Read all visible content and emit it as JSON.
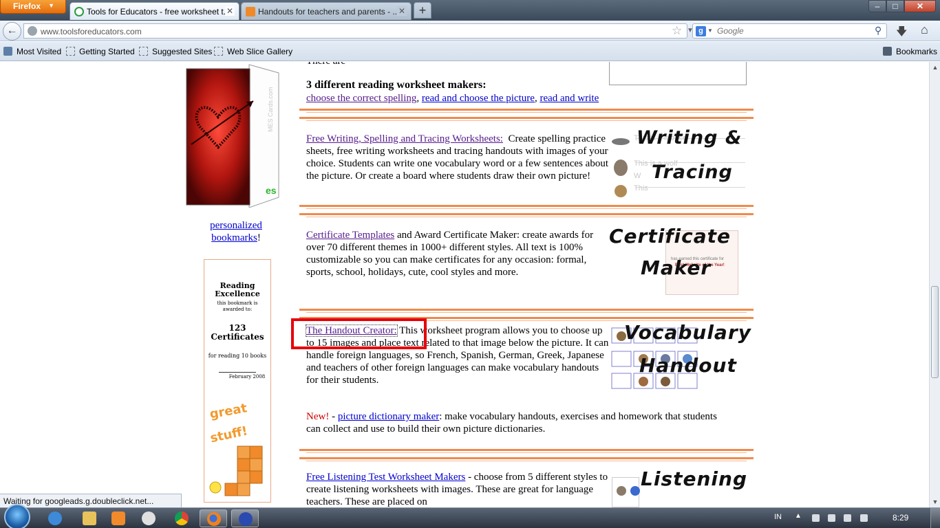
{
  "browser": {
    "app_button": "Firefox",
    "tabs": [
      {
        "title": "Tools for Educators - free worksheet t...",
        "active": true
      },
      {
        "title": "Handouts for teachers and parents - ...",
        "active": false
      }
    ],
    "new_tab": "+",
    "window_controls": {
      "minimize": "–",
      "maximize": "□",
      "close": "✕"
    },
    "url": "www.toolsforeducators.com",
    "search_placeholder": "Google",
    "search_engine_letter": "g",
    "bookmarks": [
      "Most Visited",
      "Getting Started",
      "Suggested Sites",
      "Web Slice Gallery"
    ],
    "bookmarks_menu": "Bookmarks",
    "status": "Waiting for googleads.g.doubleclick.net..."
  },
  "sidebar": {
    "card_watermark": "MES Cards.com",
    "bookmarks_link": "personalized bookmarks",
    "bookmarks_suffix": "!",
    "sample_bookmark": {
      "title": "Reading Excellence",
      "awarded": "this bookmark is awarded to:",
      "count": "123",
      "count_label": "Certificates",
      "for": "for reading 10 books",
      "date": "February 2008",
      "art_text": "great stuff!"
    }
  },
  "content": {
    "top_partial": "There are",
    "reading_heading": "3 different reading worksheet makers:",
    "reading_links": [
      "choose the correct spelling",
      "read and choose the picture",
      "read and write"
    ],
    "sections": [
      {
        "link": "Free Writing, Spelling and Tracing Worksheets:",
        "text": "Create spelling practice sheets, free writing worksheets and tracing handouts with images of your choice.  Students can write one vocabulary word or a few sentences about the picture.  Or create a board where students draw their own picture!",
        "thumb_words": [
          "Writing &",
          "Tracing"
        ],
        "thumb_bg_lines": [
          "This is a mouse",
          "This is a wolf",
          "W",
          "This"
        ]
      },
      {
        "link": "Certificate Templates",
        "text": "and Award Certificate Maker:  create awards for over 70 different themes in 1000+ different styles.  All text is 100% customizable so you can make certificates for any occasion: formal, sports, school, holidays, cute, cool styles and more.",
        "thumb_words": [
          "Certificate",
          "Maker"
        ],
        "thumb_bg_lines": [
          "has earned this certificate for",
          "Best Website of the Year!"
        ]
      },
      {
        "link": "The Handout Creator:",
        "text": "This worksheet program allows you to choose up to 15 images and place text related to that image below the picture.  It can handle foreign languages, so French, Spanish, German, Greek, Japanese and teachers of other foreign languages can make vocabulary handouts for their students.",
        "new_label": "New!",
        "new_dash": " - ",
        "new_link": "picture dictionary maker",
        "new_text": ": make vocabulary handouts, exercises and homework that students can collect and use to build their own picture dictionaries.",
        "thumb_words": [
          "Vocabulary",
          "Handout"
        ]
      },
      {
        "link": "Free Listening Test Worksheet Makers",
        "text": " - choose from 5 different styles to create listening worksheets with images.  These are great for language teachers. These are placed on",
        "thumb_words": [
          "Listening"
        ]
      }
    ]
  },
  "taskbar": {
    "language": "IN",
    "clock": "8:29"
  },
  "colors": {
    "link": "#0000cc",
    "visited": "#551a8b",
    "rule": "#f08a4b",
    "new_label": "#cc0000",
    "highlight_box": "#e8000b"
  }
}
